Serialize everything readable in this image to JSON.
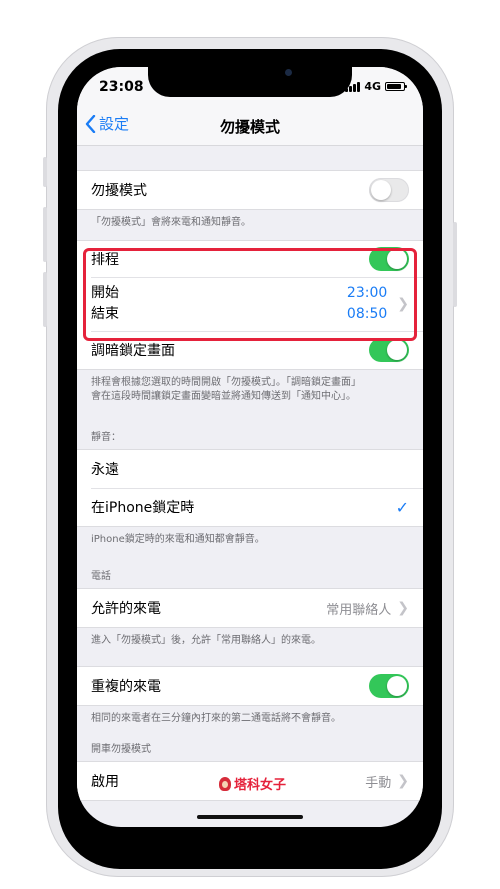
{
  "status": {
    "time": "23:08",
    "network": "4G"
  },
  "nav": {
    "back_label": "設定",
    "title": "勿擾模式"
  },
  "dnd": {
    "label": "勿擾模式",
    "toggle": "off",
    "footer": "「勿擾模式」會將來電和通知靜音。"
  },
  "schedule": {
    "label": "排程",
    "toggle": "on",
    "from_label": "開始",
    "to_label": "結束",
    "from_value": "23:00",
    "to_value": "08:50"
  },
  "dim": {
    "label": "調暗鎖定畫面",
    "toggle": "on",
    "footer_line1": "排程會根據您選取的時間開啟「勿擾模式」。「調暗鎖定畫面」",
    "footer_line2": "會在這段時間讓鎖定畫面變暗並將通知傳送到「通知中心」。"
  },
  "silence": {
    "header": "靜音：",
    "always": "永遠",
    "locked": "在iPhone鎖定時",
    "footer": "iPhone鎖定時的來電和通知都會靜音。"
  },
  "calls": {
    "header": "電話",
    "allow_label": "允許的來電",
    "allow_value": "常用聯絡人",
    "allow_footer": "進入「勿擾模式」後，允許「常用聯絡人」的來電。",
    "repeated_label": "重複的來電",
    "repeated_toggle": "on",
    "repeated_footer": "相同的來電者在三分鐘內打來的第二通電話將不會靜音。"
  },
  "driving": {
    "header": "開車勿擾模式",
    "activate_label": "啟用",
    "activate_value": "手動"
  },
  "watermark": {
    "text": "塔科女子"
  },
  "colors": {
    "accent": "#1a7cf5",
    "switch_on": "#33c759",
    "highlight": "#e5223b"
  }
}
